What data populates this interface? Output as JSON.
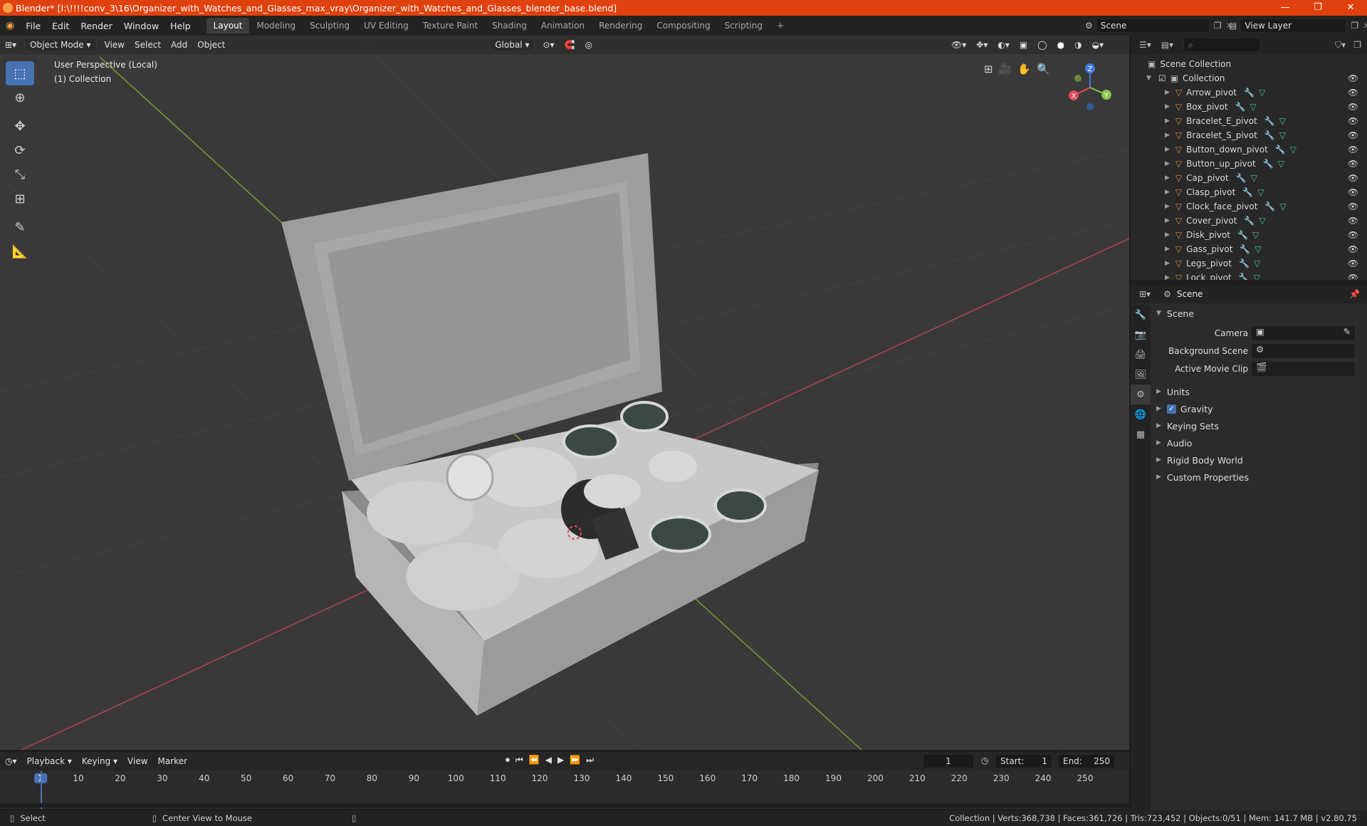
{
  "window": {
    "title": "Blender* [I:\\!!!!conv_3\\16\\Organizer_with_Watches_and_Glasses_max_vray\\Organizer_with_Watches_and_Glasses_blender_base.blend]",
    "minimize": "—",
    "maximize": "❐",
    "close": "✕"
  },
  "menu": {
    "items": [
      "File",
      "Edit",
      "Render",
      "Window",
      "Help"
    ]
  },
  "workspaces": {
    "tabs": [
      "Layout",
      "Modeling",
      "Sculpting",
      "UV Editing",
      "Texture Paint",
      "Shading",
      "Animation",
      "Rendering",
      "Compositing",
      "Scripting"
    ],
    "add": "+"
  },
  "scene_selector": {
    "value": "Scene"
  },
  "view_layer_selector": {
    "value": "View Layer"
  },
  "viewport": {
    "mode": "Object Mode",
    "menus": [
      "View",
      "Select",
      "Add",
      "Object"
    ],
    "transform_orientation": "Global",
    "overlay_line1": "User Perspective (Local)",
    "overlay_line2": "(1) Collection",
    "gizmo_axes": {
      "x": "X",
      "y": "Y",
      "z": "Z"
    }
  },
  "outliner": {
    "search_placeholder": "",
    "scene_collection": "Scene Collection",
    "collection": "Collection",
    "objects": [
      "Arrow_pivot",
      "Box_pivot",
      "Bracelet_E_pivot",
      "Bracelet_S_pivot",
      "Button_down_pivot",
      "Button_up_pivot",
      "Cap_pivot",
      "Clasp_pivot",
      "Clock_face_pivot",
      "Cover_pivot",
      "Disk_pivot",
      "Gass_pivot",
      "Legs_pivot",
      "Lock_pivot"
    ]
  },
  "properties": {
    "context": "Scene",
    "panel_title": "Scene",
    "fields": {
      "camera": "Camera",
      "background_scene": "Background Scene",
      "active_movie_clip": "Active Movie Clip"
    },
    "subpanels": [
      "Units",
      "Gravity",
      "Keying Sets",
      "Audio",
      "Rigid Body World",
      "Custom Properties"
    ],
    "gravity_checked": true
  },
  "timeline": {
    "menus": [
      "Playback",
      "Keying",
      "View",
      "Marker"
    ],
    "current_frame": "1",
    "start_label": "Start:",
    "start": "1",
    "end_label": "End:",
    "end": "250",
    "ruler": [
      "1",
      "10",
      "20",
      "30",
      "40",
      "50",
      "60",
      "70",
      "80",
      "90",
      "100",
      "110",
      "120",
      "130",
      "140",
      "150",
      "160",
      "170",
      "180",
      "190",
      "200",
      "210",
      "220",
      "230",
      "240",
      "250"
    ]
  },
  "statusbar": {
    "left_action": "Select",
    "middle_action": "Center View to Mouse",
    "stats": "Collection | Verts:368,738 | Faces:361,726 | Tris:723,452 | Objects:0/51 | Mem: 141.7 MB | v2.80.75"
  },
  "colors": {
    "titlebar": "#e0420f",
    "active_tool": "#4772b3",
    "x_axis": "#e04a5a",
    "y_axis": "#8bc34a",
    "z_axis": "#3e7be0"
  }
}
